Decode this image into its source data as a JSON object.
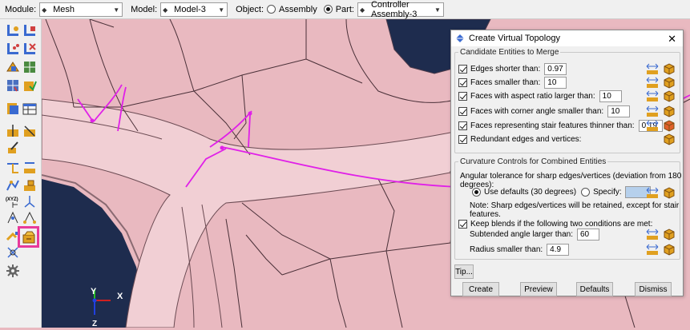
{
  "toolbar": {
    "module_label": "Module:",
    "module_value": "Mesh",
    "model_label": "Model:",
    "model_value": "Model-3",
    "object_label": "Object:",
    "assembly_label": "Assembly",
    "part_label": "Part:",
    "part_value": "Controller Assembly-3"
  },
  "dialog": {
    "title": "Create Virtual Topology",
    "close_glyph": "✕",
    "candidates": {
      "legend": "Candidate Entities to Merge",
      "rows": [
        {
          "label": "Edges shorter than:",
          "value": "0.97",
          "checked": true
        },
        {
          "label": "Faces smaller than:",
          "value": "10",
          "checked": true
        },
        {
          "label": "Faces with aspect ratio larger than:",
          "value": "10",
          "checked": true
        },
        {
          "label": "Faces with corner angle smaller than:",
          "value": "10",
          "checked": true
        },
        {
          "label": "Faces representing stair features thinner than:",
          "value": "0.19",
          "checked": true
        },
        {
          "label": "Redundant edges and vertices:",
          "checked": true
        }
      ]
    },
    "curvature": {
      "legend": "Curvature Controls for Combined Entities",
      "angular_text": "Angular tolerance for sharp edges/vertices (deviation from 180 degrees):",
      "use_defaults_label": "Use defaults (30 degrees)",
      "specify_label": "Specify:",
      "note": "Note: Sharp edges/vertices will be retained, except for stair features.",
      "keep_blends_label": "Keep blends if the following two conditions are met:",
      "subtended_label": "Subtended angle larger than:",
      "subtended_value": "60",
      "radius_label": "Radius smaller than:",
      "radius_value": "4.9"
    },
    "tip_label": "Tip...",
    "buttons": {
      "create": "Create",
      "preview": "Preview",
      "defaults": "Defaults",
      "dismiss": "Dismiss"
    }
  },
  "triad": {
    "x": "X",
    "y": "Y",
    "z": "Z"
  },
  "colors": {
    "model_pink": "#e9b9c0",
    "highlight": "#e8399b",
    "edge_magenta": "#e020e8",
    "hole_navy": "#1e2c4e"
  }
}
